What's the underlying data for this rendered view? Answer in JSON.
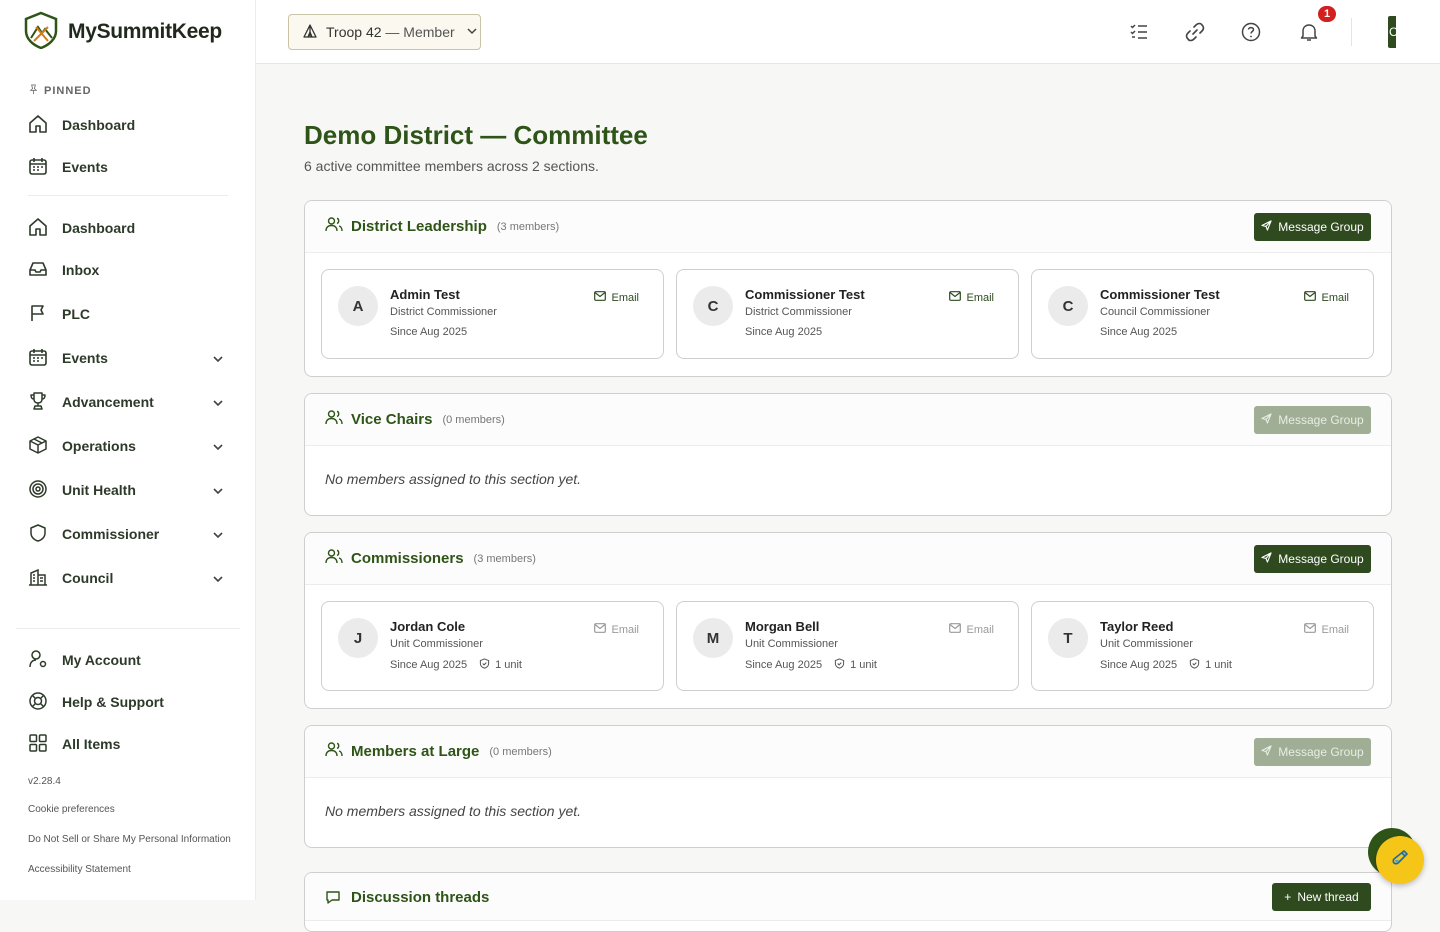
{
  "app": {
    "name": "MySummitKeep",
    "version": "v2.28.4"
  },
  "sidebar": {
    "pinned_label": "PINNED",
    "pinned": [
      {
        "label": "Dashboard",
        "icon": "home-icon"
      },
      {
        "label": "Events",
        "icon": "calendar-icon"
      }
    ],
    "items": [
      {
        "label": "Dashboard",
        "icon": "home-icon",
        "expandable": false
      },
      {
        "label": "Inbox",
        "icon": "inbox-icon",
        "expandable": false
      },
      {
        "label": "PLC",
        "icon": "flag-icon",
        "expandable": false
      },
      {
        "label": "Events",
        "icon": "calendar-icon",
        "expandable": true
      },
      {
        "label": "Advancement",
        "icon": "trophy-icon",
        "expandable": true
      },
      {
        "label": "Operations",
        "icon": "box-icon",
        "expandable": true
      },
      {
        "label": "Unit Health",
        "icon": "target-icon",
        "expandable": true
      },
      {
        "label": "Commissioner",
        "icon": "shield-icon",
        "expandable": true
      },
      {
        "label": "Council",
        "icon": "building-icon",
        "expandable": true
      }
    ],
    "account_items": [
      {
        "label": "My Account",
        "icon": "user-gear-icon"
      },
      {
        "label": "Help & Support",
        "icon": "lifebuoy-icon"
      },
      {
        "label": "All Items",
        "icon": "grid-icon"
      }
    ],
    "footer_links": [
      "Cookie preferences",
      "Do Not Sell or Share My Personal Information",
      "Accessibility Statement"
    ]
  },
  "topbar": {
    "troop_name": "Troop 42",
    "troop_role": "— Member",
    "notification_count": "1",
    "avatar_initial": "C"
  },
  "page": {
    "title": "Demo District — Committee",
    "subtitle": "6 active committee members across 2 sections."
  },
  "sections": [
    {
      "title": "District Leadership",
      "count": "(3 members)",
      "message_label": "Message Group",
      "message_enabled": true,
      "members": [
        {
          "initial": "A",
          "name": "Admin Test",
          "role": "District Commissioner",
          "since": "Since Aug 2025",
          "email": "Email",
          "email_active": true
        },
        {
          "initial": "C",
          "name": "Commissioner Test",
          "role": "District Commissioner",
          "since": "Since Aug 2025",
          "email": "Email",
          "email_active": true
        },
        {
          "initial": "C",
          "name": "Commissioner Test",
          "role": "Council Commissioner",
          "since": "Since Aug 2025",
          "email": "Email",
          "email_active": true
        }
      ]
    },
    {
      "title": "Vice Chairs",
      "count": "(0 members)",
      "message_label": "Message Group",
      "message_enabled": false,
      "empty_text": "No members assigned to this section yet."
    },
    {
      "title": "Commissioners",
      "count": "(3 members)",
      "message_label": "Message Group",
      "message_enabled": true,
      "members": [
        {
          "initial": "J",
          "name": "Jordan Cole",
          "role": "Unit Commissioner",
          "since": "Since Aug 2025",
          "unit": "1 unit",
          "email": "Email",
          "email_active": false
        },
        {
          "initial": "M",
          "name": "Morgan Bell",
          "role": "Unit Commissioner",
          "since": "Since Aug 2025",
          "unit": "1 unit",
          "email": "Email",
          "email_active": false
        },
        {
          "initial": "T",
          "name": "Taylor Reed",
          "role": "Unit Commissioner",
          "since": "Since Aug 2025",
          "unit": "1 unit",
          "email": "Email",
          "email_active": false
        }
      ]
    },
    {
      "title": "Members at Large",
      "count": "(0 members)",
      "message_label": "Message Group",
      "message_enabled": false,
      "empty_text": "No members assigned to this section yet."
    }
  ],
  "threads": {
    "title": "Discussion threads",
    "new_label": "New thread"
  },
  "colors": {
    "brand_green": "#2f5418",
    "button_green": "#2f4a1f",
    "badge_red": "#d21f1f",
    "fab_yellow": "#f5c518"
  }
}
